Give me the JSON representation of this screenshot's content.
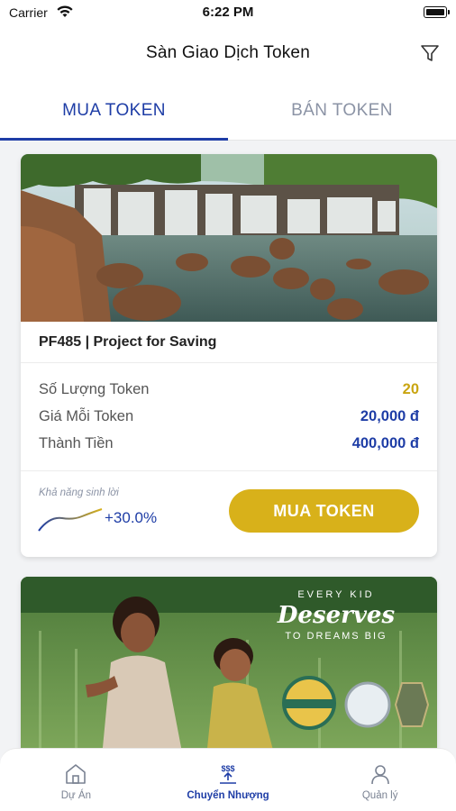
{
  "status_bar": {
    "carrier": "Carrier",
    "time": "6:22 PM"
  },
  "header": {
    "title": "Sàn Giao Dịch Token"
  },
  "tabs": [
    {
      "label": "MUA TOKEN",
      "active": true
    },
    {
      "label": "BÁN TOKEN",
      "active": false
    }
  ],
  "card": {
    "project_title": "PF485 | Project for Saving",
    "rows": [
      {
        "label": "Số Lượng Token",
        "value": "20"
      },
      {
        "label": "Giá Mỗi Token",
        "value": "20,000 đ"
      },
      {
        "label": "Thành Tiền",
        "value": "400,000 đ"
      }
    ],
    "yield_label": "Khả năng sinh lời",
    "yield_value": "+30.0%",
    "buy_label": "MUA TOKEN"
  },
  "banner": {
    "line1": "EVERY KID",
    "line2": "Deserves",
    "line3": "TO DREAMS BIG"
  },
  "bottom_nav": [
    {
      "label": "Dự Án",
      "icon": "home-icon",
      "active": false
    },
    {
      "label": "Chuyển Nhượng",
      "icon": "transfer-icon",
      "active": true
    },
    {
      "label": "Quản lý",
      "icon": "user-icon",
      "active": false
    }
  ],
  "colors": {
    "primary": "#1e3da6",
    "accent": "#d8b11a",
    "muted": "#8b93a5"
  }
}
